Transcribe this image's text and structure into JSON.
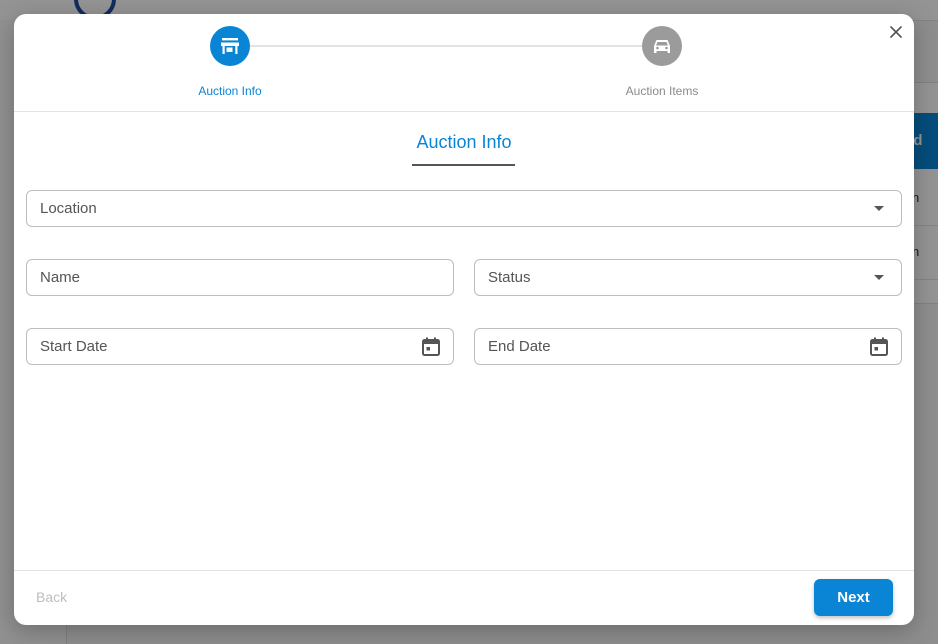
{
  "background": {
    "header_fragment": "ted",
    "row_fragments": [
      "n",
      "n"
    ]
  },
  "stepper": {
    "steps": [
      {
        "label": "Auction Info",
        "icon": "store-icon",
        "active": true
      },
      {
        "label": "Auction Items",
        "icon": "car-icon",
        "active": false
      }
    ]
  },
  "section": {
    "title": "Auction Info"
  },
  "form": {
    "location": {
      "placeholder": "Location",
      "value": ""
    },
    "name": {
      "placeholder": "Name",
      "value": ""
    },
    "status": {
      "placeholder": "Status",
      "value": ""
    },
    "start_date": {
      "placeholder": "Start Date",
      "value": ""
    },
    "end_date": {
      "placeholder": "End Date",
      "value": ""
    }
  },
  "footer": {
    "back_label": "Back",
    "next_label": "Next"
  },
  "colors": {
    "accent": "#0a85d6",
    "inactive_step": "#9b9b9b",
    "disabled_text": "#bdbdbd"
  }
}
